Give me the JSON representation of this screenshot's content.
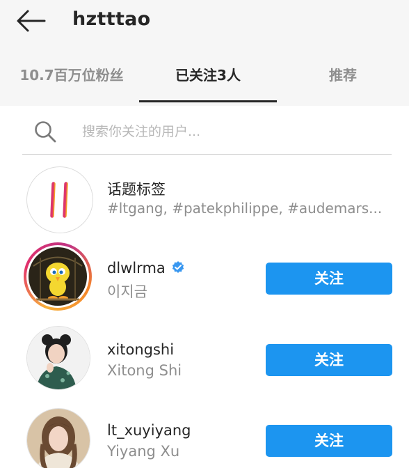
{
  "header": {
    "title": "hztttao",
    "back_icon": "arrow-left-icon"
  },
  "tabs": [
    {
      "label": "10.7百万位粉丝",
      "active": false
    },
    {
      "label": "已关注3人",
      "active": true
    },
    {
      "label": "推荐",
      "active": false
    }
  ],
  "search": {
    "placeholder": "搜索你关注的用户...",
    "icon": "search-icon"
  },
  "hashtags": {
    "title": "话题标签",
    "subtitle": "#ltgang, #patekphilippe, #audemars...",
    "icon": "hashtag-icon"
  },
  "users": [
    {
      "username": "dlwlrma",
      "full_name": "이지금",
      "verified": true,
      "button_label": "关注",
      "has_story_ring": true
    },
    {
      "username": "xitongshi",
      "full_name": "Xitong Shi",
      "verified": false,
      "button_label": "关注",
      "has_story_ring": false
    },
    {
      "username": "lt_xuyiyang",
      "full_name": "Yiyang Xu",
      "verified": false,
      "button_label": "关注",
      "has_story_ring": false
    }
  ],
  "colors": {
    "follow_button": "#1c95f0",
    "verified_badge": "#3897f0",
    "story_ring_start": "#f7b03a",
    "story_ring_end": "#c13584"
  }
}
